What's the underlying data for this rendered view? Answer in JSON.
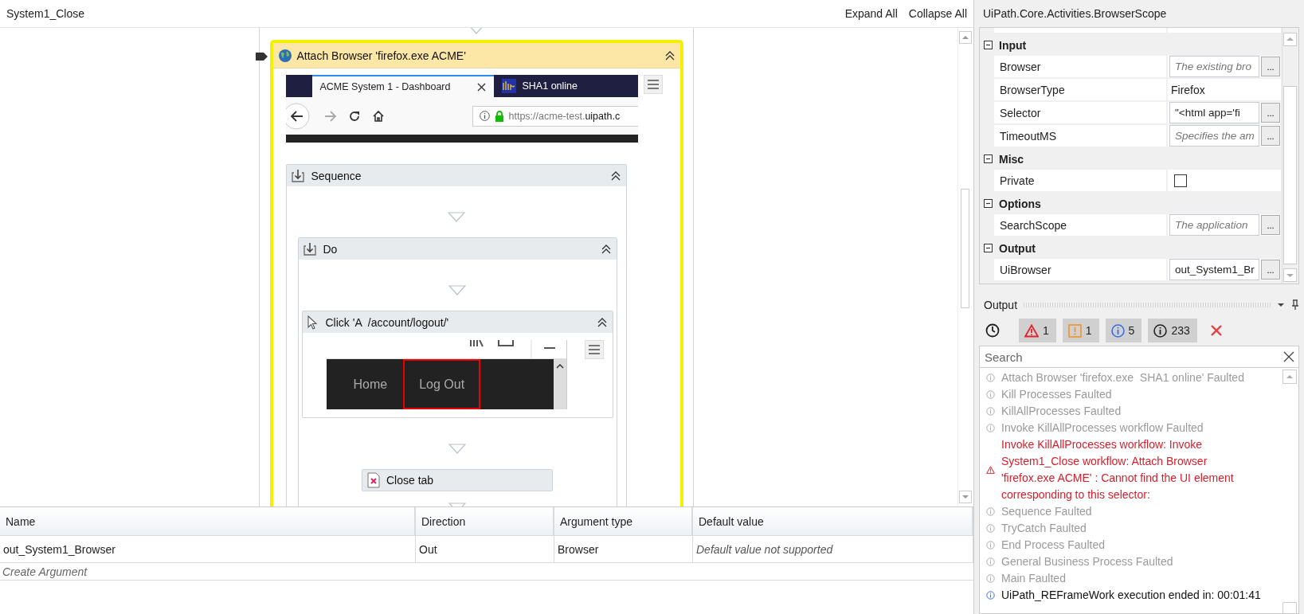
{
  "header": {
    "title": "System1_Close",
    "actions": [
      "Expand All",
      "Collapse All"
    ]
  },
  "designer": {
    "activity": {
      "title": "Attach Browser 'firefox.exe ACME'",
      "screenshot": {
        "tabs": [
          {
            "label": "ACME System 1 - Dashboard",
            "selected": true
          },
          {
            "label": "SHA1 online",
            "selected": false
          }
        ],
        "url_prefix": "https://acme-test.",
        "url_domain": "uipath.c"
      },
      "sequence": {
        "title": "Sequence",
        "do": {
          "title": "Do",
          "click": {
            "title": "Click 'A  /account/logout/'",
            "screenshot": {
              "nav": [
                {
                  "label": "Home",
                  "selected": false
                },
                {
                  "label": "Log Out",
                  "selected": true
                }
              ]
            }
          },
          "close_tab": {
            "title": "Close tab"
          }
        }
      }
    }
  },
  "arguments": {
    "columns": [
      "Name",
      "Direction",
      "Argument type",
      "Default value"
    ],
    "rows": [
      [
        "out_System1_Browser",
        "Out",
        "Browser",
        "Default value not supported"
      ]
    ],
    "create": "Create Argument"
  },
  "properties": {
    "title": "UiPath.Core.Activities.BrowserScope",
    "categories": [
      {
        "name": "Input",
        "expanded": true,
        "rows": [
          {
            "name": "Browser",
            "kind": "field",
            "placeholder": "The existing bro",
            "button": "..."
          },
          {
            "name": "BrowserType",
            "kind": "text",
            "value": "Firefox"
          },
          {
            "name": "Selector",
            "kind": "field",
            "value": "\"<html app='fi",
            "button": "..."
          },
          {
            "name": "TimeoutMS",
            "kind": "field",
            "placeholder": "Specifies the am",
            "button": "..."
          }
        ]
      },
      {
        "name": "Misc",
        "expanded": true,
        "rows": [
          {
            "name": "Private",
            "kind": "checkbox",
            "checked": false
          }
        ]
      },
      {
        "name": "Options",
        "expanded": true,
        "rows": [
          {
            "name": "SearchScope",
            "kind": "field",
            "placeholder": "The application",
            "button": "..."
          }
        ]
      },
      {
        "name": "Output",
        "expanded": true,
        "rows": [
          {
            "name": "UiBrowser",
            "kind": "field",
            "value": "out_System1_Br",
            "button": "..."
          }
        ]
      }
    ]
  },
  "output": {
    "title": "Output",
    "filters": [
      {
        "kind": "error",
        "count": "1",
        "on": true
      },
      {
        "kind": "warning",
        "count": "1",
        "on": true
      },
      {
        "kind": "info",
        "count": "5",
        "on": true
      },
      {
        "kind": "trace",
        "count": "233",
        "on": true
      }
    ],
    "search": {
      "placeholder": "Search"
    },
    "log": [
      {
        "kind": "trace",
        "text": "Attach Browser 'firefox.exe  SHA1 online' Faulted"
      },
      {
        "kind": "trace",
        "text": "Kill Processes Faulted"
      },
      {
        "kind": "trace",
        "text": "KillAllProcesses Faulted"
      },
      {
        "kind": "trace",
        "text": "Invoke KillAllProcesses workflow Faulted"
      },
      {
        "kind": "error",
        "text": "Invoke KillAllProcesses workflow: Invoke System1_Close workflow: Attach Browser 'firefox.exe ACME' : Cannot find the UI element corresponding to this selector:"
      },
      {
        "kind": "trace",
        "text": "Sequence Faulted"
      },
      {
        "kind": "trace",
        "text": "TryCatch Faulted"
      },
      {
        "kind": "trace",
        "text": "End Process Faulted"
      },
      {
        "kind": "trace",
        "text": "General Business Process Faulted"
      },
      {
        "kind": "trace",
        "text": "Main Faulted"
      },
      {
        "kind": "info",
        "text": "UiPath_REFrameWork execution ended in: 00:01:41"
      }
    ]
  }
}
